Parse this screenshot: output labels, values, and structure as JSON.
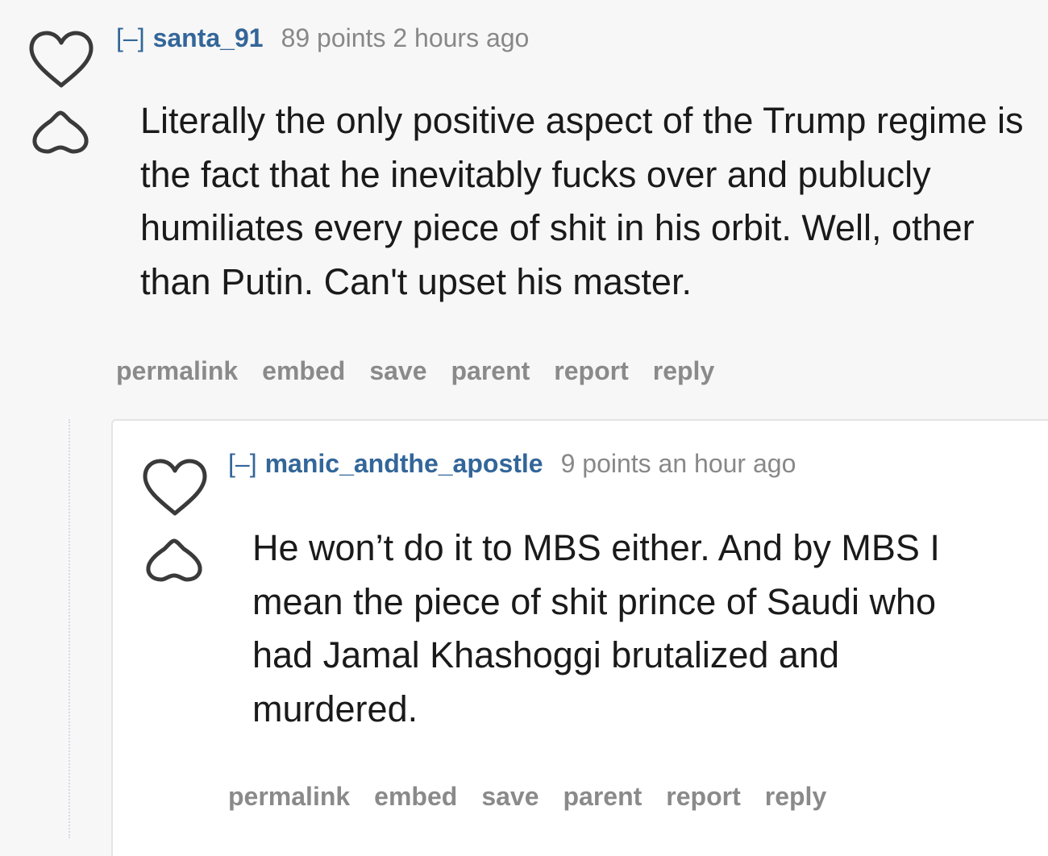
{
  "comments": [
    {
      "collapse": "[–]",
      "author": "santa_91",
      "meta": "89 points 2 hours ago",
      "body": "Literally the only positive aspect of the Trump regime is the fact that he inevitably fucks over and publucly humiliates every piece of shit in his orbit. Well, other than Putin. Can't upset his master.",
      "actions": [
        "permalink",
        "embed",
        "save",
        "parent",
        "report",
        "reply"
      ]
    },
    {
      "collapse": "[–]",
      "author": "manic_andthe_apostle",
      "meta": "9 points an hour ago",
      "body": "He won’t do it to MBS either. And by MBS I mean the piece of shit prince of Saudi who had Jamal Khashoggi brutalized and murdered.",
      "actions": [
        "permalink",
        "embed",
        "save",
        "parent",
        "report",
        "reply"
      ]
    }
  ],
  "icons": {
    "upvote": "heart-outline-icon",
    "downvote": "cloud-outline-icon"
  },
  "colors": {
    "link": "#336699",
    "meta": "#888888",
    "text": "#1a1a1a",
    "background": "#f7f7f7"
  }
}
